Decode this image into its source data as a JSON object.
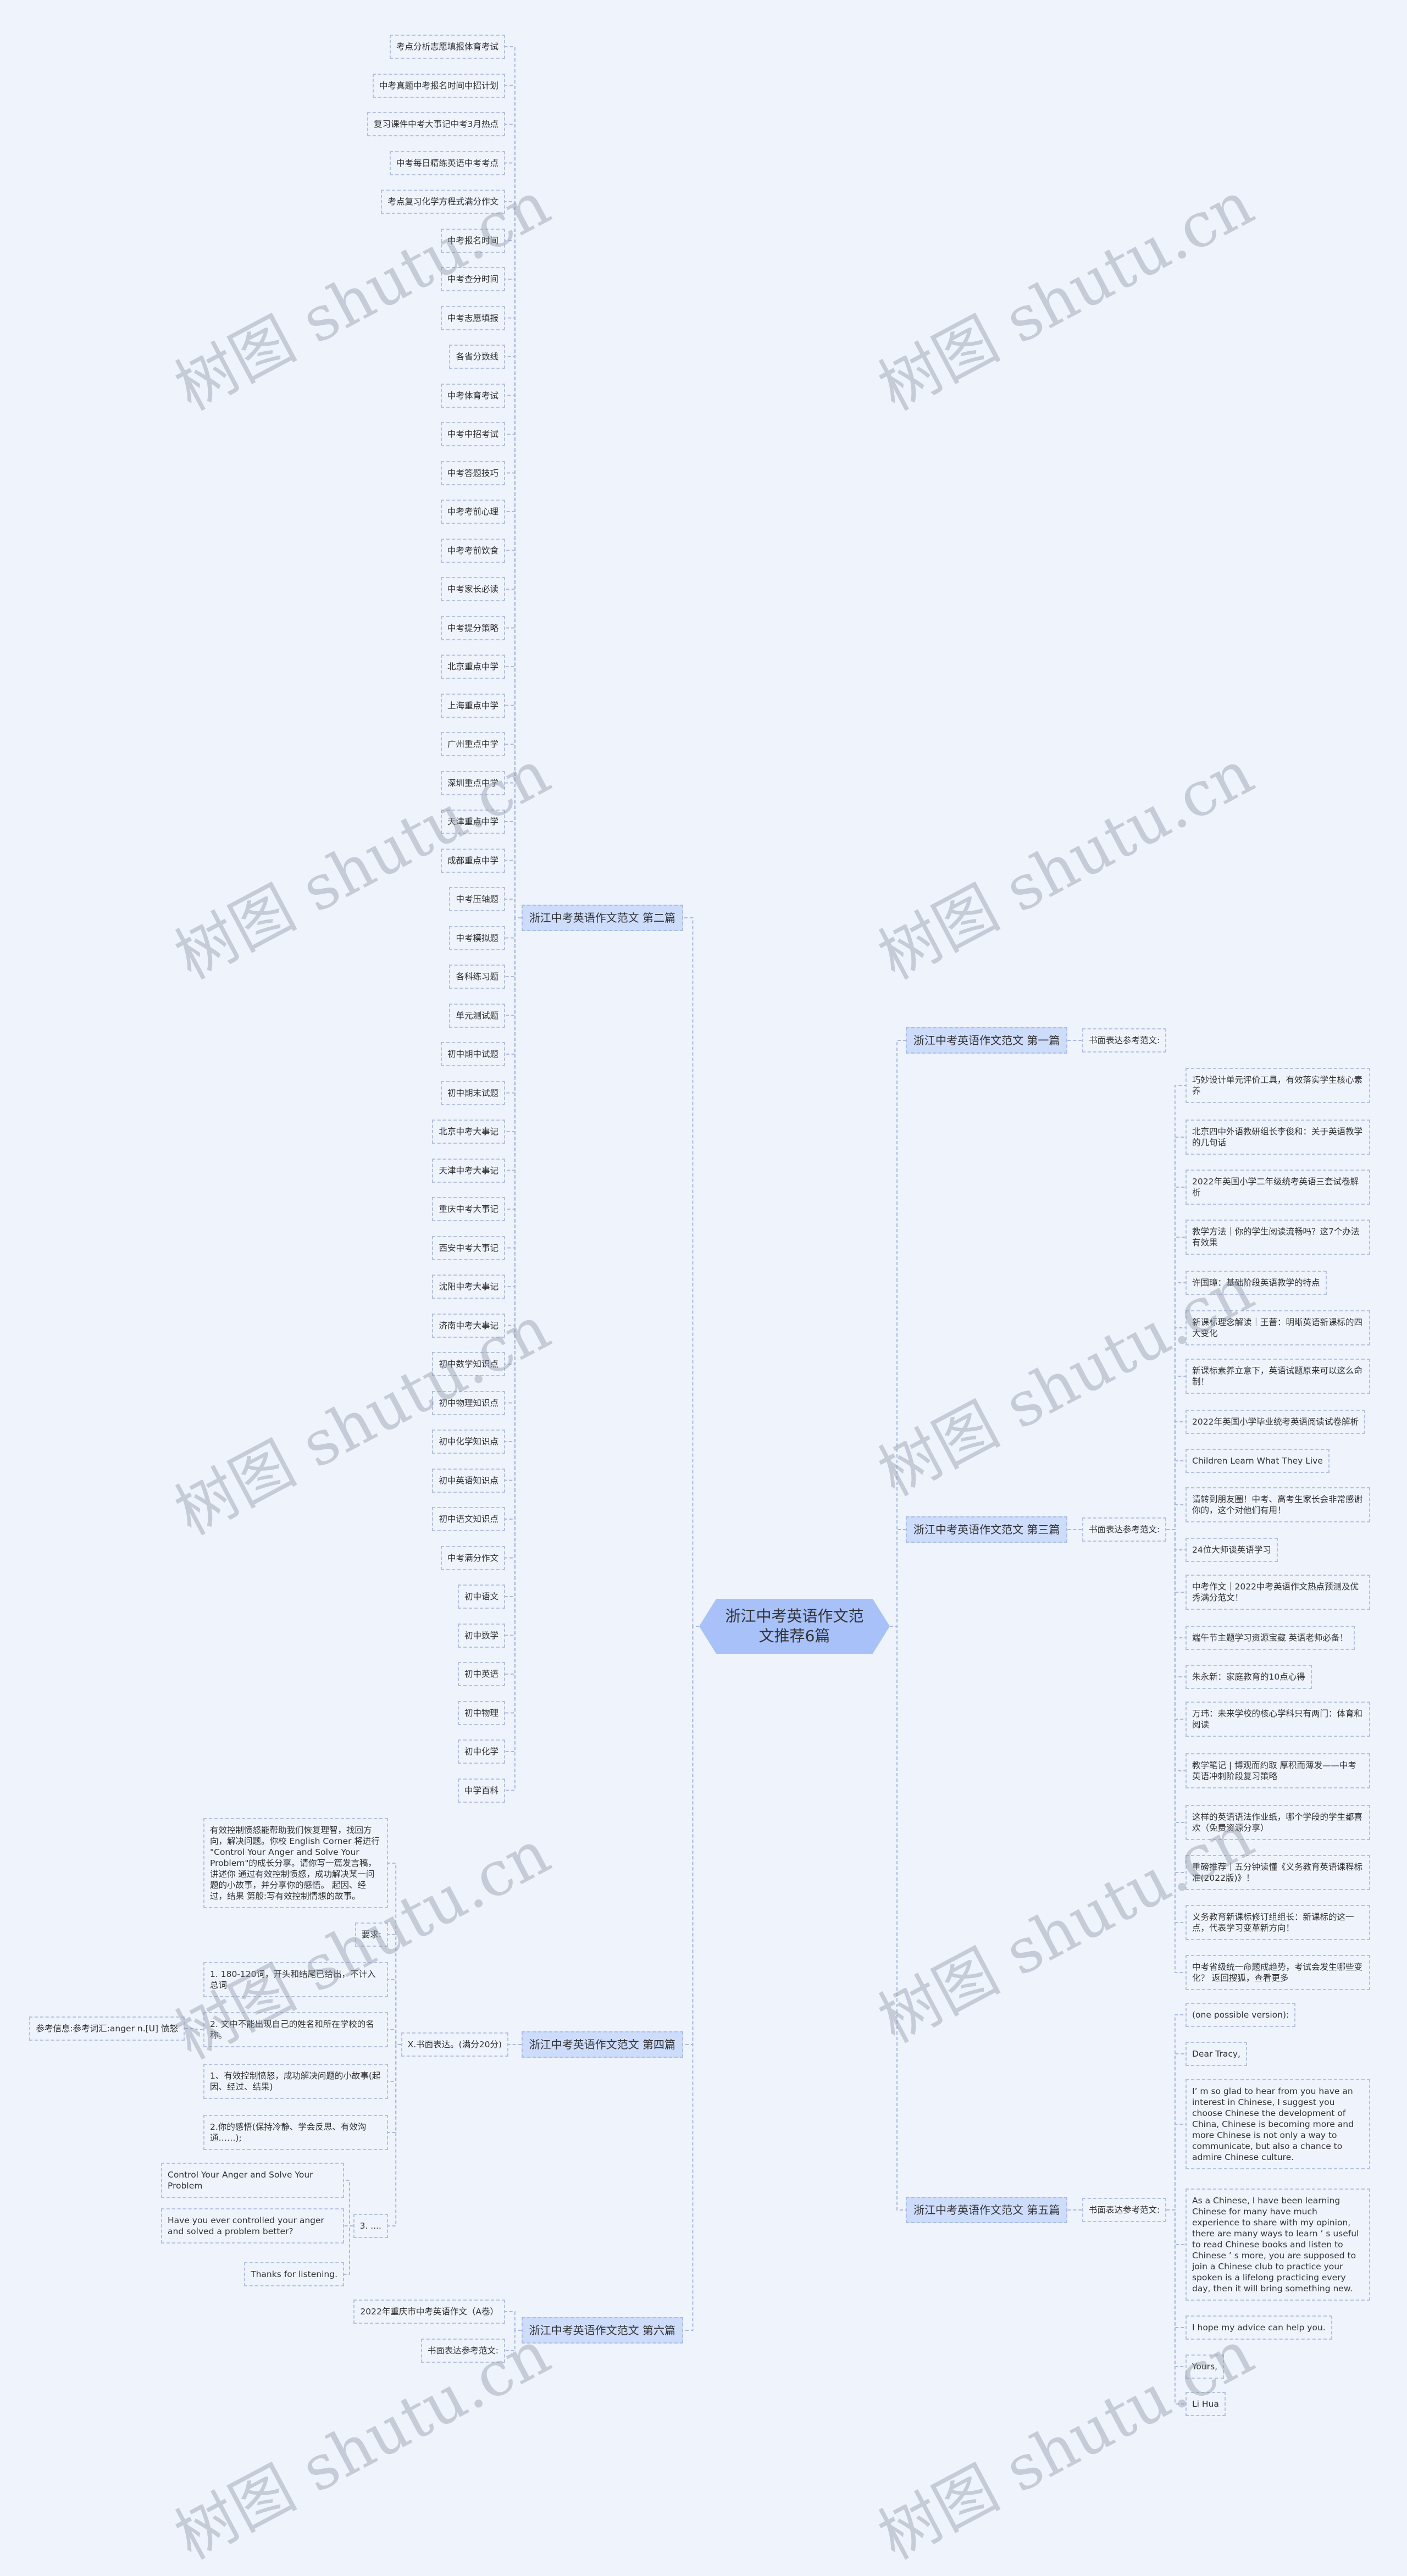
{
  "root": {
    "title": "浙江中考英语作文范文推荐6篇"
  },
  "colors": {
    "background": "#eef3fc",
    "root_fill": "#a8c1f8",
    "section_fill": "#cddcfb",
    "border": "#b5c1e0",
    "connector": "#a9b9e0"
  },
  "watermark": "树图 shutu.cn",
  "s1": {
    "title": "浙江中考英语作文范文 第一篇",
    "label": "书面表达参考范文:"
  },
  "s2": {
    "title": "浙江中考英语作文范文 第二篇",
    "items": [
      "考点分析志愿填报体育考试",
      "中考真题中考报名时间中招计划",
      "复习课件中考大事记中考3月热点",
      "中考每日精练英语中考考点",
      "考点复习化学方程式满分作文",
      "中考报名时间",
      "中考查分时间",
      "中考志愿填报",
      "各省分数线",
      "中考体育考试",
      "中考中招考试",
      "中考答题技巧",
      "中考考前心理",
      "中考考前饮食",
      "中考家长必读",
      "中考提分策略",
      "北京重点中学",
      "上海重点中学",
      "广州重点中学",
      "深圳重点中学",
      "天津重点中学",
      "成都重点中学",
      "中考压轴题",
      "中考模拟题",
      "各科练习题",
      "单元测试题",
      "初中期中试题",
      "初中期末试题",
      "北京中考大事记",
      "天津中考大事记",
      "重庆中考大事记",
      "西安中考大事记",
      "沈阳中考大事记",
      "济南中考大事记",
      "初中数学知识点",
      "初中物理知识点",
      "初中化学知识点",
      "初中英语知识点",
      "初中语文知识点",
      "中考满分作文",
      "初中语文",
      "初中数学",
      "初中英语",
      "初中物理",
      "初中化学",
      "中学百科"
    ]
  },
  "s3": {
    "title": "浙江中考英语作文范文 第三篇",
    "label": "书面表达参考范文:",
    "items": [
      "巧妙设计单元评价工具，有效落实学生核心素养",
      "北京四中外语教研组长李俊和：关于英语教学的几句话",
      "2022年英国小学二年级统考英语三套试卷解析",
      "教学方法｜你的学生阅读流畅吗？这7个办法有效果",
      "许国璋：基础阶段英语教学的特点",
      "新课标理念解读｜王蔷：明晰英语新课标的四大变化",
      "新课标素养立意下，英语试题原来可以这么命制！",
      "2022年英国小学毕业统考英语阅读试卷解析",
      "Children Learn What They Live",
      "请转到朋友圈！中考、高考生家长会非常感谢你的，这个对他们有用！",
      "24位大师谈英语学习",
      "中考作文｜2022中考英语作文热点预测及优秀满分范文！",
      "端午节主题学习资源宝藏 英语老师必备！",
      "朱永新：家庭教育的10点心得",
      "万玮：未来学校的核心学科只有两门：体育和阅读",
      "教学笔记 | 博观而约取 厚积而薄发——中考英语冲刺阶段复习策略",
      "这样的英语语法作业纸，哪个学段的学生都喜欢（免费资源分享）",
      "重磅推荐｜五分钟读懂《义务教育英语课程标准(2022版)》！",
      "义务教育新课标修订组组长：新课标的这一点，代表学习变革新方向！",
      "中考省级统一命题成趋势，考试会发生哪些变化？ 返回搜狐，查看更多"
    ]
  },
  "s4": {
    "title": "浙江中考英语作文范文 第四篇",
    "label": "X.书面表达。(满分20分)",
    "prompt": "有效控制愤怒能帮助我们恢复理智，找回方向，解决问题。你校 English Corner 将进行 \"Control Your Anger and Solve Your Problem\"的成长分享。请你写一篇发言稿，讲述你 通过有效控制愤怒，成功解决某一问题的小故事，并分享你的感悟。 起因、经过，结果 第般:写有效控制情想的故事。",
    "requirement": "要求:",
    "req1": "1. 180-120词，开头和结尾已给出，不计入总词",
    "req2": "2. 文中不能出现自己的姓名和所在学校的名称。",
    "reference": "参考信息:参考词汇:anger n.[U] 愤怒",
    "point1": "1、有效控制愤怒，成功解决问题的小故事(起因、经过、结果)",
    "point2": "2.你的感悟(保持冷静、学会反思、有效沟通……);",
    "point3": "3. ....",
    "point3_items": [
      "Control Your Anger and Solve Your Problem",
      "Have you ever controlled your anger and solved a problem better?",
      "Thanks for listening."
    ]
  },
  "s5": {
    "title": "浙江中考英语作文范文 第五篇",
    "label": "书面表达参考范文:",
    "items": [
      "(one possible version):",
      "Dear Tracy,",
      "I’  m so glad to hear from  you have an interest in Chinese, I suggest you choose Chinese  the development of China, Chinese is becoming more and more Chinese is not only a way to communicate, but also a chance to admire Chinese culture.",
      "As a Chinese, I have been learning Chinese for many  have much experience to share with  my opinion, there are many ways to learn ’  s useful to read Chinese books and listen to Chinese ’  s more, you are supposed to join a Chinese  club to practice your spoken  is a lifelong   practicing every day, then it will bring something new.",
      "I hope my advice can help you.",
      "Yours,",
      "Li Hua"
    ]
  },
  "s6": {
    "title": "浙江中考英语作文范文 第六篇",
    "items": [
      "2022年重庆市中考英语作文（A卷）",
      "书面表达参考范文:"
    ]
  }
}
